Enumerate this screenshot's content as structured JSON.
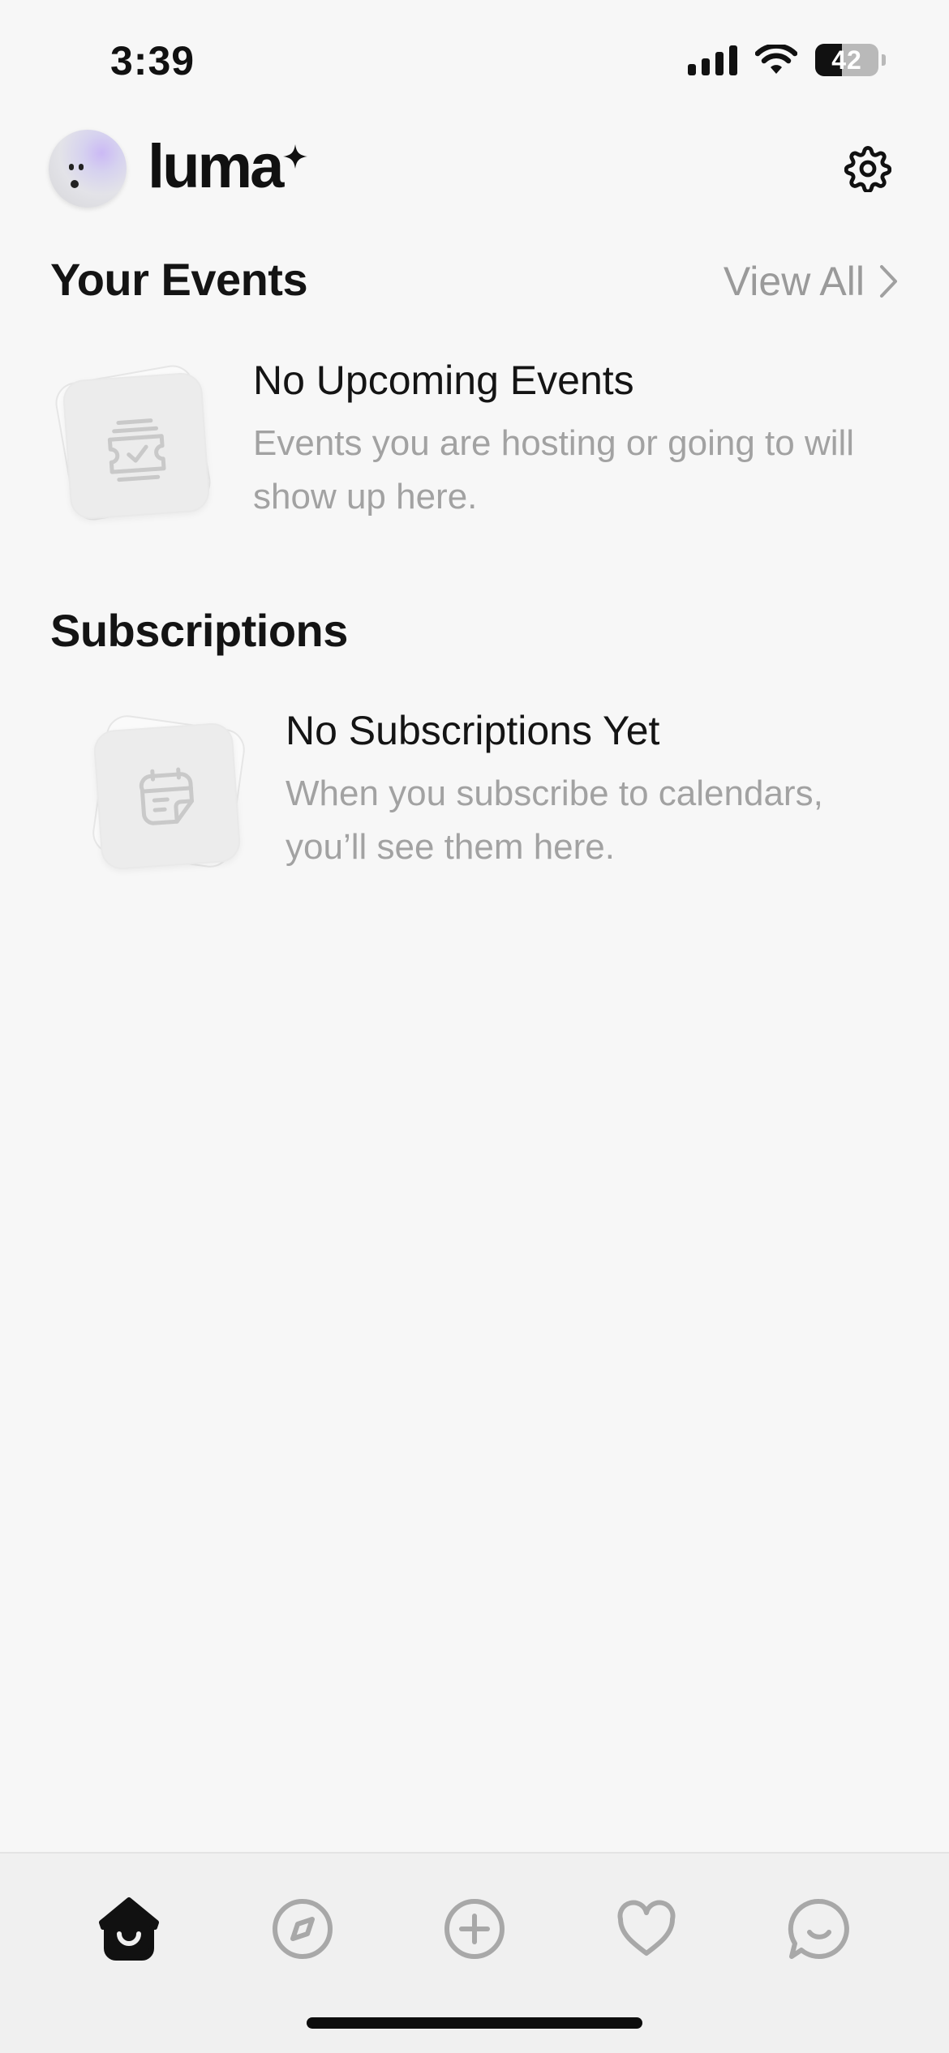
{
  "status_bar": {
    "time": "3:39",
    "battery_text": "42",
    "battery_level": 0.42,
    "icons": [
      "signal-icon",
      "wifi-icon",
      "battery-icon"
    ]
  },
  "header": {
    "brand": "luma",
    "settings_icon": "gear-icon"
  },
  "your_events": {
    "title": "Your Events",
    "view_all_label": "View All",
    "empty_title": "No Upcoming Events",
    "empty_desc_line1": "Events you are hosting or going to will",
    "empty_desc_line2": "show up here.",
    "illustration_icon": "ticket-icon"
  },
  "subscriptions": {
    "title": "Subscriptions",
    "empty_title": "No Subscriptions Yet",
    "empty_desc_line1": "When you subscribe to calendars,",
    "empty_desc_line2": "you’ll see them here.",
    "illustration_icon": "calendar-icon"
  },
  "tab_bar": {
    "items": [
      {
        "name": "home",
        "icon": "home-icon",
        "active": true
      },
      {
        "name": "discover",
        "icon": "compass-icon",
        "active": false
      },
      {
        "name": "create",
        "icon": "plus-circle-icon",
        "active": false
      },
      {
        "name": "favorites",
        "icon": "heart-icon",
        "active": false
      },
      {
        "name": "chat",
        "icon": "chat-icon",
        "active": false
      }
    ]
  },
  "colors": {
    "background": "#f7f7f7",
    "text_primary": "#141414",
    "text_secondary": "#a2a2a2",
    "icon_inactive": "#a8a8a8",
    "icon_active": "#111111"
  }
}
